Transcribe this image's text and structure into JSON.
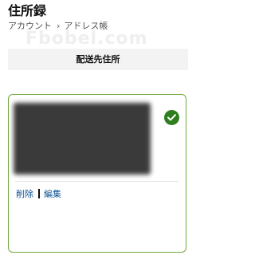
{
  "page": {
    "title": "住所録",
    "watermark": "Fbobel.com"
  },
  "breadcrumb": {
    "account": "アカウント",
    "separator": "›",
    "current": "アドレス帳"
  },
  "section": {
    "label": "配送先住所"
  },
  "address_card": {
    "selected": true,
    "delete_label": "削除",
    "edit_label": "編集"
  },
  "colors": {
    "card_border": "#73a83e",
    "check_fill": "#2e7d1f",
    "link": "#0b5394",
    "section_bg": "#f3f3f3"
  }
}
